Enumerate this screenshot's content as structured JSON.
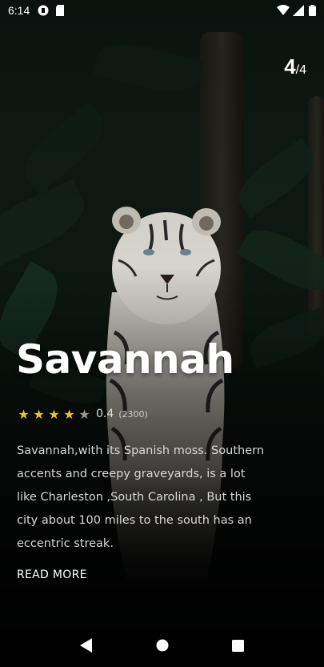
{
  "status_bar": {
    "time": "6:14",
    "icons": [
      "app-icon",
      "sd-card-icon"
    ],
    "right_icons": [
      "wifi-icon",
      "signal-icon",
      "battery-icon"
    ]
  },
  "counter": {
    "current": "4",
    "total": "/4"
  },
  "place": {
    "title": "Savannah",
    "rating": {
      "stars_filled": 4,
      "stars_total": 5,
      "score": "0.4",
      "count": "(2300)"
    },
    "description": "Savannah,with its Spanish moss. Southern accents and creepy graveyards, is a lot like Charleston ,South Carolina , But this city about 100 miles to the south has an eccentric streak.",
    "read_more": "READ MORE"
  },
  "navigation": {
    "buttons": [
      "back-icon",
      "home-icon",
      "recents-icon"
    ]
  },
  "colors": {
    "star": "#f2c316",
    "star_off": "#9a9a9a",
    "background": "#0d1812"
  }
}
